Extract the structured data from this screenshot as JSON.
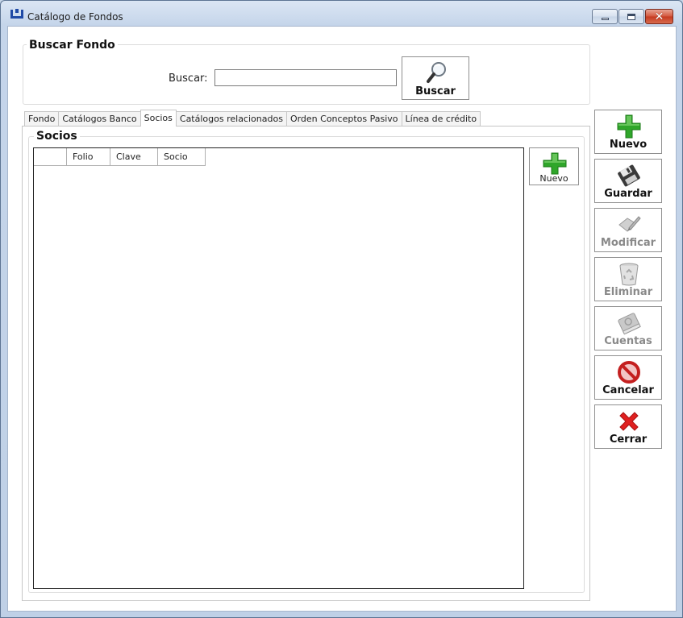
{
  "window": {
    "title": "Catálogo de Fondos",
    "controls": [
      "minimize",
      "maximize",
      "close"
    ]
  },
  "buscar_group": {
    "legend": "Buscar Fondo",
    "label": "Buscar:",
    "input_value": "",
    "button_label": "Buscar",
    "button_icon": "magnifier-icon"
  },
  "tabs": [
    {
      "label": "Fondo",
      "active": false
    },
    {
      "label": "Catálogos Banco",
      "active": false
    },
    {
      "label": "Socios",
      "active": true
    },
    {
      "label": "Catálogos relacionados",
      "active": false
    },
    {
      "label": "Orden Conceptos Pasivo",
      "active": false
    },
    {
      "label": "Línea de crédito",
      "active": false
    }
  ],
  "socios_group": {
    "legend": "Socios",
    "columns": [
      "Folio",
      "Clave",
      "Socio"
    ],
    "rows": [],
    "nuevo_label": "Nuevo",
    "nuevo_icon": "plus-icon"
  },
  "actions": [
    {
      "label": "Nuevo",
      "icon": "plus-icon",
      "enabled": true
    },
    {
      "label": "Guardar",
      "icon": "save-icon",
      "enabled": true
    },
    {
      "label": "Modificar",
      "icon": "edit-icon",
      "enabled": false
    },
    {
      "label": "Eliminar",
      "icon": "recycle-bin-icon",
      "enabled": false
    },
    {
      "label": "Cuentas",
      "icon": "book-icon",
      "enabled": false
    },
    {
      "label": "Cancelar",
      "icon": "cancel-icon",
      "enabled": true
    },
    {
      "label": "Cerrar",
      "icon": "close-x-icon",
      "enabled": true
    }
  ],
  "colors": {
    "plus_green": "#2fa62a",
    "cancel_red": "#d12b2b",
    "close_red": "#e02020",
    "disabled_gray": "#a0a0a0"
  }
}
